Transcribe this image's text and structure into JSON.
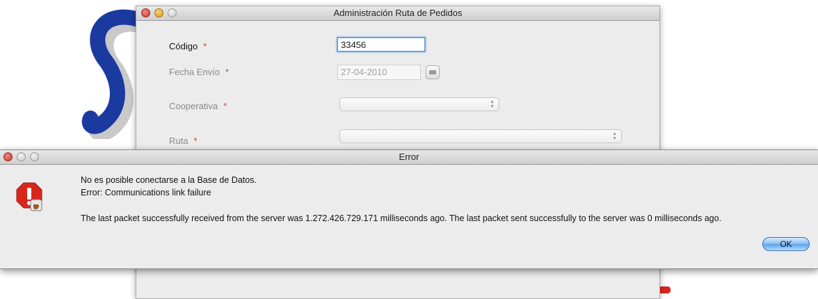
{
  "background_window": {
    "title": "Administración Ruta de Pedidos",
    "form": {
      "codigo_label": "Código",
      "codigo_value": "33456",
      "fecha_label": "Fecha Envío",
      "fecha_value": "27-04-2010",
      "cooperativa_label": "Cooperativa",
      "cooperativa_value": "",
      "ruta_label": "Ruta",
      "ruta_value": "",
      "required_marker": "*"
    }
  },
  "error_dialog": {
    "title": "Error",
    "line1": "No es posible conectarse a la Base de Datos.",
    "line2": "Error: Communications link failure",
    "line3": "The last packet successfully received from the server was 1.272.426.729.171 milliseconds ago.  The last packet sent successfully to the server was 0 milliseconds ago.",
    "ok_label": "OK"
  },
  "colors": {
    "required_marker": "#d04040",
    "ok_button": "#5ea4ec",
    "logo_blue": "#1a3aa0",
    "alert_red": "#d9261c"
  }
}
